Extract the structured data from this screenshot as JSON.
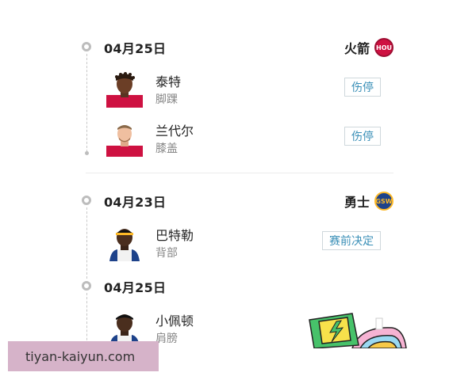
{
  "sections": [
    {
      "date": "04月25日",
      "team": {
        "name": "火箭",
        "logo_text": "HOU",
        "color": "#ce1141"
      },
      "players": [
        {
          "name": "泰特",
          "injury": "脚踝",
          "status": "伤停"
        },
        {
          "name": "兰代尔",
          "injury": "膝盖",
          "status": "伤停"
        }
      ]
    },
    {
      "date": "04月23日",
      "team": {
        "name": "勇士",
        "logo_text": "GSW",
        "color": "#1d428a"
      },
      "players": [
        {
          "name": "巴特勒",
          "injury": "背部",
          "status": "赛前决定"
        }
      ]
    },
    {
      "date": "04月25日",
      "players": [
        {
          "name": "小佩顿",
          "injury": "肩膀"
        }
      ]
    }
  ],
  "watermark": "tiyan-kaiyun.com"
}
